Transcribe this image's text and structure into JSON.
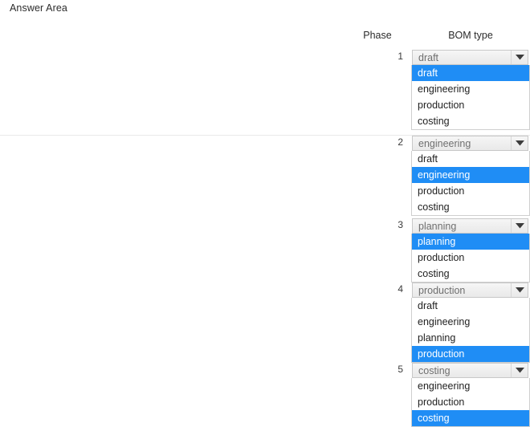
{
  "page": {
    "title": "Answer Area"
  },
  "table": {
    "headers": {
      "phase": "Phase",
      "bom_type": "BOM type"
    },
    "colors": {
      "selection_blue": "#1f8df5",
      "selection_text": "#ffffff",
      "combobox_text": "#6f6f6f",
      "list_text": "#1f1f1f",
      "border": "#cfcfcf"
    },
    "rows": [
      {
        "number": "1",
        "selected_value": "draft",
        "options": [
          {
            "label": "draft",
            "selected": true
          },
          {
            "label": "engineering",
            "selected": false
          },
          {
            "label": "production",
            "selected": false
          },
          {
            "label": "costing",
            "selected": false
          }
        ]
      },
      {
        "number": "2",
        "selected_value": "engineering",
        "options": [
          {
            "label": "draft",
            "selected": false
          },
          {
            "label": "engineering",
            "selected": true
          },
          {
            "label": "production",
            "selected": false
          },
          {
            "label": "costing",
            "selected": false
          }
        ]
      },
      {
        "number": "3",
        "selected_value": "planning",
        "options": [
          {
            "label": "planning",
            "selected": true
          },
          {
            "label": "production",
            "selected": false
          },
          {
            "label": "costing",
            "selected": false
          }
        ]
      },
      {
        "number": "4",
        "selected_value": "production",
        "options": [
          {
            "label": "draft",
            "selected": false
          },
          {
            "label": "engineering",
            "selected": false
          },
          {
            "label": "planning",
            "selected": false
          },
          {
            "label": "production",
            "selected": true
          }
        ]
      },
      {
        "number": "5",
        "selected_value": "costing",
        "options": [
          {
            "label": "engineering",
            "selected": false
          },
          {
            "label": "production",
            "selected": false
          },
          {
            "label": "costing",
            "selected": true
          }
        ]
      }
    ]
  },
  "layout": {
    "row_tops": [
      62,
      169,
      272,
      352,
      452
    ],
    "dropdown_arrow_icon": "chevron-down-icon"
  }
}
